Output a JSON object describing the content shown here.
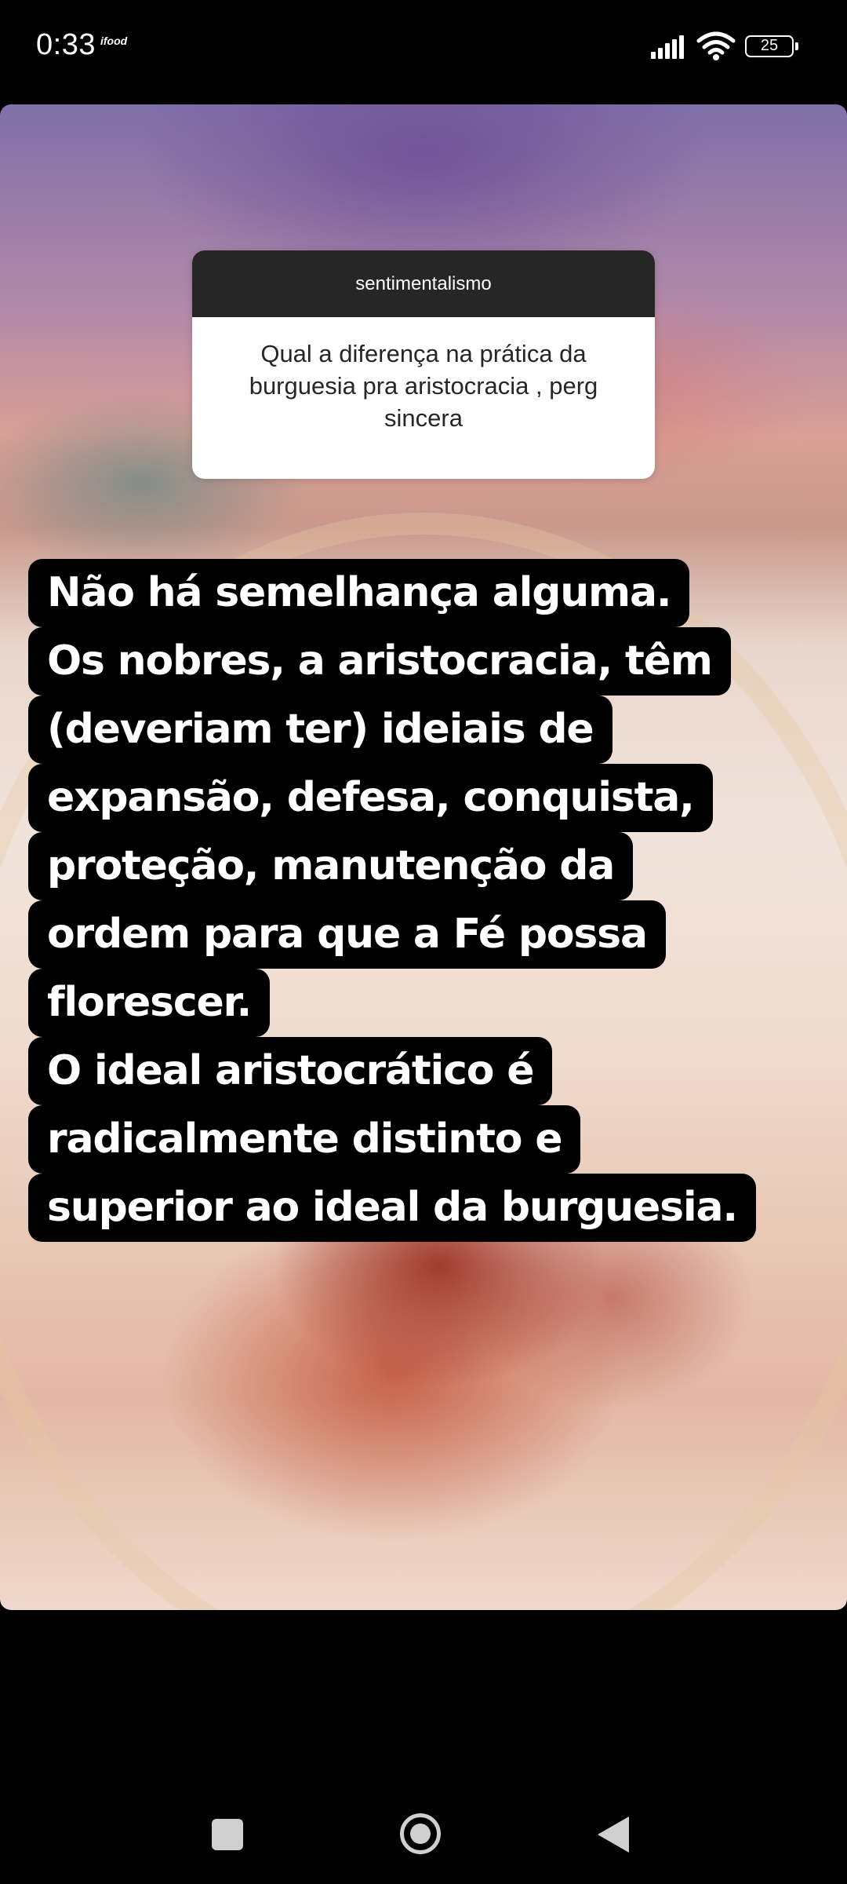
{
  "status_bar": {
    "time": "0:33",
    "app_icon": "ifood",
    "signal_icon": "signal-bars-icon",
    "wifi_icon": "wifi-icon",
    "battery": "25"
  },
  "question_sticker": {
    "username": "sentimentalismo",
    "question": "Qual a diferença na prática da burguesia pra aristocracia , perg sincera"
  },
  "answer": {
    "lines": [
      "Não há semelhança alguma.",
      "Os nobres, a aristocracia, têm",
      "(deveriam ter) ideiais de",
      "expansão, defesa, conquista,",
      "proteção, manutenção da",
      "ordem para que a Fé possa",
      "florescer.",
      "O ideal aristocrático é",
      "radicalmente distinto e",
      "superior ao ideal da burguesia."
    ]
  },
  "nav_bar": {
    "recents_icon": "square-recents-icon",
    "home_icon": "circle-home-icon",
    "back_icon": "triangle-back-icon"
  }
}
